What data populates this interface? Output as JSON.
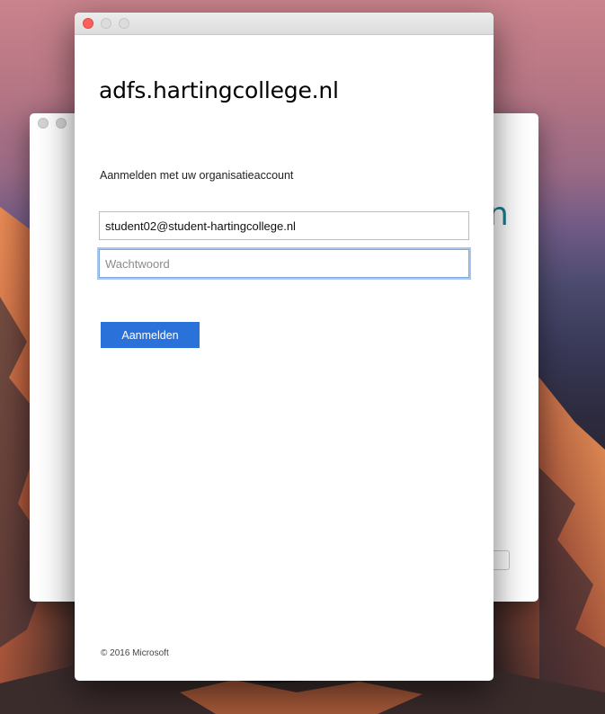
{
  "desktop": {
    "wallpaper": "mountain-sunset"
  },
  "back_window": {
    "partial_text": "n"
  },
  "front_window": {
    "site_title": "adfs.hartingcollege.nl",
    "signin_label": "Aanmelden met uw organisatieaccount",
    "email_value": "student02@student-hartingcollege.nl",
    "password_placeholder": "Wachtwoord",
    "signin_button_label": "Aanmelden",
    "footer": "© 2016 Microsoft"
  },
  "colors": {
    "accent": "#2a71d9",
    "close_button": "#fc605c"
  }
}
